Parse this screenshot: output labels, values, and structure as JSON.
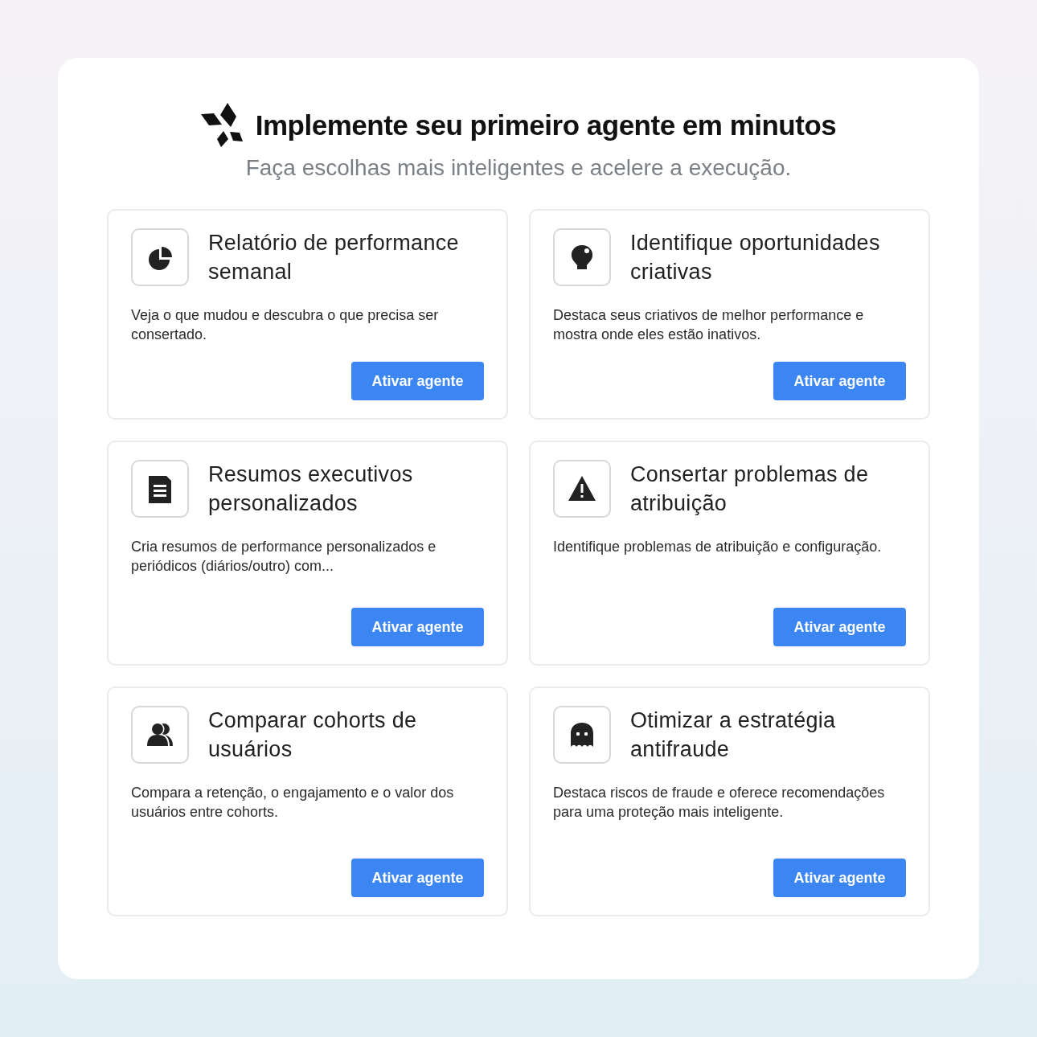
{
  "header": {
    "title": "Implemente seu primeiro agente em minutos",
    "subtitle": "Faça escolhas mais inteligentes e acelere a execução."
  },
  "cards": [
    {
      "title": "Relatório de performance semanal",
      "description": "Veja o que mudou e descubra o que precisa ser consertado.",
      "button": "Ativar agente"
    },
    {
      "title": "Identifique oportunidades criativas",
      "description": "Destaca seus criativos de melhor performance e mostra onde eles estão inativos.",
      "button": "Ativar agente"
    },
    {
      "title": "Resumos executivos personalizados",
      "description": "Cria resumos de performance personalizados e periódicos (diários/outro) com...",
      "button": "Ativar agente"
    },
    {
      "title": "Consertar problemas de atribuição",
      "description": "Identifique problemas de atribuição e configuração.",
      "button": "Ativar agente"
    },
    {
      "title": "Comparar cohorts de usuários",
      "description": "Compara a retenção, o engajamento e o valor dos usuários entre cohorts.",
      "button": "Ativar agente"
    },
    {
      "title": "Otimizar a estratégia antifraude",
      "description": "Destaca riscos de fraude e oferece recomendações para uma proteção mais inteligente.",
      "button": "Ativar agente"
    }
  ]
}
